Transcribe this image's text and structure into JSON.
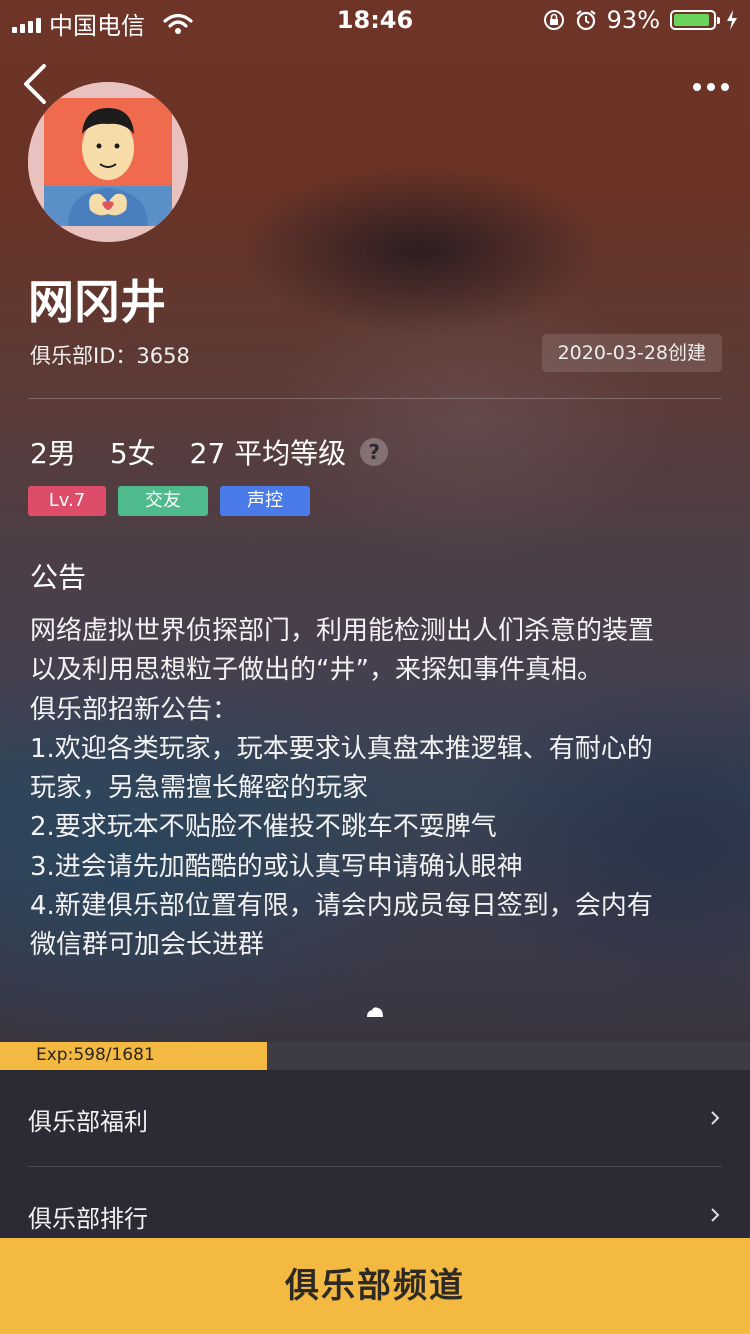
{
  "status_bar": {
    "carrier": "中国电信",
    "time": "18:46",
    "battery_percent": "93%",
    "battery_level": 0.93,
    "icons": [
      "signal-icon",
      "wifi-icon",
      "orientation-lock-icon",
      "alarm-icon",
      "battery-icon",
      "charging-icon"
    ]
  },
  "nav": {
    "back_icon": "chevron-left-icon",
    "more_icon": "more-dots-icon"
  },
  "club": {
    "name": "网冈井",
    "id_text": "俱乐部ID：3658",
    "created_text": "2020-03-28创建",
    "stats": {
      "male": "2男",
      "female": "5女",
      "avg_level": "27 平均等级"
    },
    "help_symbol": "?",
    "tags": [
      {
        "label": "Lv.7",
        "color": "#dd4c68"
      },
      {
        "label": "交友",
        "color": "#4fba8c"
      },
      {
        "label": "声控",
        "color": "#4a7be9"
      }
    ]
  },
  "notice": {
    "title": "公告",
    "lines": [
      "网络虚拟世界侦探部门，利用能检测出人们杀意的装置",
      "以及利用思想粒子做出的“井”，来探知事件真相。",
      "俱乐部招新公告：",
      "1.欢迎各类玩家，玩本要求认真盘本推逻辑、有耐心的",
      "玩家，另急需擅长解密的玩家",
      "2.要求玩本不贴脸不催投不跳车不耍脾气",
      "3.进会请先加酷酷的或认真写申请确认眼神",
      "4.新建俱乐部位置有限，请会内成员每日签到，会内有",
      "微信群可加会长进群"
    ]
  },
  "exp": {
    "text": "Exp:598/1681",
    "current": 598,
    "max": 1681,
    "color": "#f3b941"
  },
  "menu": {
    "items": [
      {
        "label": "俱乐部福利"
      },
      {
        "label": "俱乐部排行"
      }
    ]
  },
  "bottom_button": {
    "label": "俱乐部频道",
    "color": "#f3b941"
  }
}
